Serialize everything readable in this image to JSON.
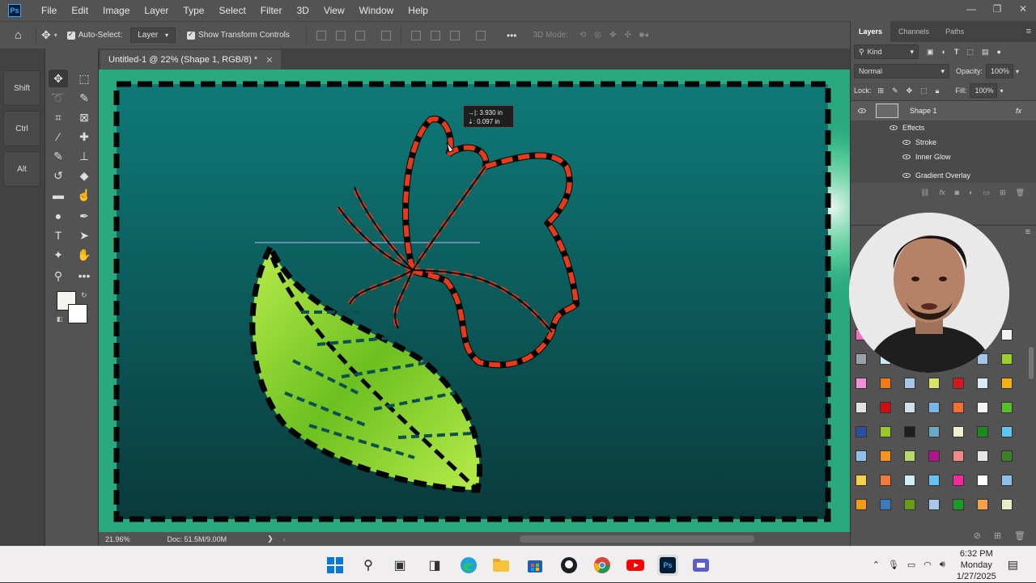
{
  "app": {
    "logo": "Ps",
    "menu": [
      "File",
      "Edit",
      "Image",
      "Layer",
      "Type",
      "Select",
      "Filter",
      "3D",
      "View",
      "Window",
      "Help"
    ],
    "window_controls": [
      "—",
      "❐",
      "✕"
    ]
  },
  "options_bar": {
    "auto_select_label": "Auto-Select:",
    "auto_select_target": "Layer",
    "show_transform_label": "Show Transform Controls",
    "more_label": "•••",
    "mode_3d_label": "3D Mode:"
  },
  "modifier_keys": [
    "Shift",
    "Ctrl",
    "Alt"
  ],
  "document_tab": {
    "title": "Untitled-1 @ 22% (Shape 1, RGB/8) *",
    "close": "✕"
  },
  "transform_readout": {
    "line1": "3.930 in",
    "line2": "0.097 in"
  },
  "status_bar": {
    "zoom": "21.96%",
    "doc_info": "Doc: 51.5M/9.00M",
    "arrow": "❯"
  },
  "layers_panel": {
    "tabs": [
      "Layers",
      "Channels",
      "Paths"
    ],
    "active_tab": "Layers",
    "filter_kind": "Kind",
    "blend_mode": "Normal",
    "opacity_label": "Opacity:",
    "opacity_value": "100%",
    "lock_label": "Lock:",
    "fill_label": "Fill:",
    "fill_value": "100%",
    "layer_name": "Shape 1",
    "fx_label": "fx",
    "effects_label": "Effects",
    "effects": [
      "Stroke",
      "Inner Glow",
      "Gradient Overlay"
    ]
  },
  "swatch_colors": [
    [
      "#f06fc0",
      "#f2f2f2",
      "#f2f2f2",
      "#f2f2f2",
      "#f2f2f2",
      "#f2f2f2",
      "#f2f2f2"
    ],
    [
      "#9aa3a8",
      "#cfeaf6",
      "#d9e88a",
      "#f2b02a",
      "#f2a21b",
      "#a6c6e8",
      "#9dcf2c"
    ],
    [
      "#f08fd6",
      "#f37a14",
      "#a6c6e8",
      "#d9e36a",
      "#d11a1a",
      "#d8ecf7",
      "#f4b00c"
    ],
    [
      "#e4e4e4",
      "#cc1010",
      "#cfe2ec",
      "#7fb4e6",
      "#f06f31",
      "#f4f4f4",
      "#58bf2a"
    ],
    [
      "#2a4ea0",
      "#9cc72a",
      "#1e1e1e",
      "#6aa9c8",
      "#f0f0d0",
      "#1a8a1a",
      "#5bc6f0"
    ],
    [
      "#8fc2ea",
      "#f6921e",
      "#b6d96a",
      "#b0168a",
      "#f08a8a",
      "#e6e6e6",
      "#3f7f2a"
    ],
    [
      "#f6d04a",
      "#f07a3a",
      "#d0ecf7",
      "#6ac0f0",
      "#ef2a9a",
      "#ffffff",
      "#8dbfe6"
    ],
    [
      "#f39a1a",
      "#3a7ac0",
      "#6a9a1a",
      "#a8c8ee",
      "#1a9a2a",
      "#f2a24a",
      "#e6f0c8"
    ]
  ],
  "taskbar": {
    "clock_time": "6:32 PM",
    "clock_day": "Monday",
    "clock_date": "1/27/2025"
  },
  "canvas": {
    "background_top": "#0e7a78",
    "background_bottom": "#0a3a3c",
    "frame_color": "#2aa97f",
    "leaf_color": "#9fdc3a",
    "flower_outline": "#e83a1a"
  }
}
